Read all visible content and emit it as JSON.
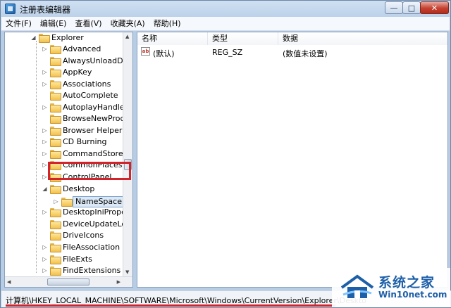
{
  "window": {
    "title": "注册表编辑器"
  },
  "menu": [
    "文件(F)",
    "编辑(E)",
    "查看(V)",
    "收藏夹(A)",
    "帮助(H)"
  ],
  "tree": {
    "parent": "Explorer",
    "children": [
      "Advanced",
      "AlwaysUnloadDLL",
      "AppKey",
      "Associations",
      "AutoComplete",
      "AutoplayHandlers",
      "BrowseNewProce",
      "Browser Helper C",
      "CD Burning",
      "CommandStore",
      "CommonPlaces",
      "ControlPanel",
      "Desktop"
    ],
    "selected": "NameSpace",
    "after": [
      "DesktopIniPropei",
      "DeviceUpdateLoca",
      "DriveIcons",
      "FileAssociation",
      "FileExts",
      "FindExtensions"
    ]
  },
  "list": {
    "columns": [
      "名称",
      "类型",
      "数据"
    ],
    "rows": [
      {
        "icon": "ab",
        "name": "(默认)",
        "type": "REG_SZ",
        "data": "(数值未设置)"
      }
    ]
  },
  "status": {
    "path": "计算机\\HKEY_LOCAL_MACHINE\\SOFTWARE\\Microsoft\\Windows\\CurrentVersion\\Explorer\\Deskto"
  },
  "watermark": {
    "title": "系统之家",
    "url": "Win10net.com"
  },
  "colors": {
    "highlight": "#d3232a",
    "brand": "#1d5fa8"
  }
}
